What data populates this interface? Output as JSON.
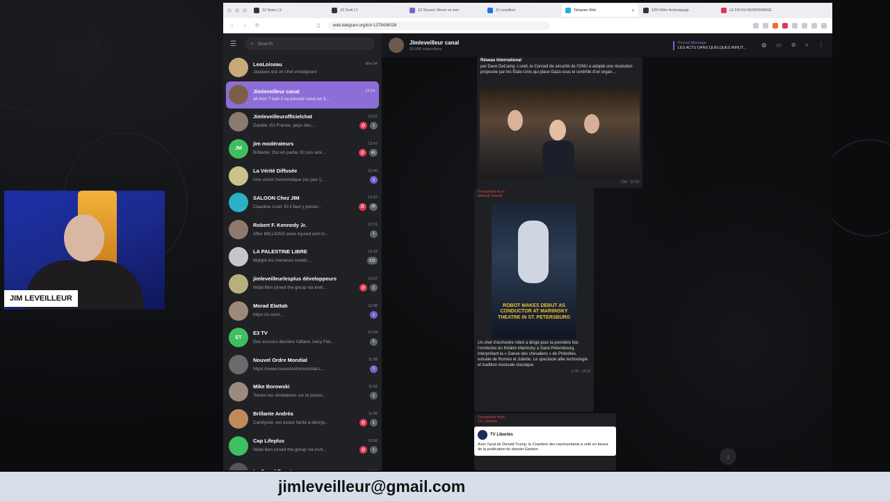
{
  "browser": {
    "tabs": [
      {
        "title": "ZZ Notes | X",
        "color": "#333"
      },
      {
        "title": "ZZ Draft | X",
        "color": "#333"
      },
      {
        "title": "ZZ Discord: Moner en vers",
        "color": "#7d5fd0"
      },
      {
        "title": "Zz Leveilleur",
        "color": "#1a73e8"
      },
      {
        "title": "Telegram Web",
        "color": "#29a9eb",
        "active": true
      },
      {
        "title": "ZZR-Hêtre Archiviquage",
        "color": "#333"
      },
      {
        "title": "LE FIN DU MUNDOMINGE",
        "color": "#e0364f"
      }
    ],
    "url": "web.telegram.org/k/#-1379436028",
    "close_glyph": "✕"
  },
  "telegram": {
    "search_placeholder": "Search",
    "chats": [
      {
        "name": "LeoLoiseau",
        "time": "Mar 04",
        "msg": "Jacques est un chef enseignant",
        "avatar_color": "#c8a97a",
        "badge": "",
        "mention": false
      },
      {
        "name": "Jimleveilleur canal",
        "time": "12:10",
        "msg": "ah bon ? bah il va pouvoir nous en fi...",
        "avatar_color": "#7a5e4a",
        "badge": "",
        "mention": false,
        "active": true
      },
      {
        "name": "Jimleveilleurofficielchat",
        "time": "12:07",
        "msg": "Davide: En France, pays des...",
        "avatar_color": "#8a7a70",
        "badge": "1",
        "mention": true
      },
      {
        "name": "jim modérateurs",
        "time": "12:47",
        "msg": "Brillante: Oui en partie. Et son ami...",
        "avatar_color": "#3fbf5f",
        "initials": "JM",
        "badge": "41",
        "mention": true
      },
      {
        "name": "La Vérité Diffusée",
        "time": "12:00",
        "msg": "Une vision humoristique (ou pas !)...",
        "avatar_color": "#c9c28a",
        "badge": "5",
        "mention": false,
        "purple": true
      },
      {
        "name": "SALOON Chez JIM",
        "time": "12:47",
        "msg": "Claudine Livet: Et il faut y préser...",
        "avatar_color": "#2bb1c4",
        "badge": "32",
        "mention": true
      },
      {
        "name": "Robert F. Kennedy Jr.",
        "time": "12:31",
        "msg": "After MILLIONS were injured and m...",
        "avatar_color": "#8d7a6c",
        "badge": "1",
        "mention": false
      },
      {
        "name": "LA PALESTINE LIBRE",
        "time": "12:19",
        "msg": "Malgré les menaces israéli...",
        "avatar_color": "#c7c7c7",
        "badge": "131",
        "mention": false
      },
      {
        "name": "jimleveilleurlesplus développeurs",
        "time": "12:07",
        "msg": "Nidal Ben joined the group via invit...",
        "avatar_color": "#b8b07a",
        "badge": "1",
        "mention": true
      },
      {
        "name": "Morad Elattab",
        "time": "12:05",
        "msg": "https://x.com/...",
        "avatar_color": "#a08878",
        "badge": "1",
        "mention": false,
        "purple": true
      },
      {
        "name": "E3 TV",
        "time": "12:04",
        "msg": "Des escrocs derrière l'affaire Juicy Fiel...",
        "avatar_color": "#3fbf5f",
        "initials": "ET",
        "badge": "1",
        "mention": false
      },
      {
        "name": "Nouvel Ordre Mondial",
        "time": "11:58",
        "msg": "https://www.nouvelordremondial.c...",
        "avatar_color": "#6a6a6a",
        "badge": "1",
        "mention": false,
        "purple": true
      },
      {
        "name": "Mike Borowski",
        "time": "11:53",
        "msg": "Toutes les révélations sur le pouvo...",
        "avatar_color": "#9b8a7e",
        "badge": "1",
        "mention": false
      },
      {
        "name": "Brillante Andréa",
        "time": "11:49",
        "msg": "Candysse, est assez facile à décryp...",
        "avatar_color": "#c28a5a",
        "badge": "1",
        "mention": true
      },
      {
        "name": "Cap Lifeplus",
        "time": "10:56",
        "msg": "Nidal Ben joined the group via invit...",
        "avatar_color": "#3fbf5f",
        "badge": "1",
        "mention": true
      },
      {
        "name": "Le Grand Reset",
        "time": "10:40",
        "msg": "",
        "avatar_color": "#555",
        "badge": "",
        "mention": false
      }
    ],
    "channel": {
      "title": "Jimleveilleur canal",
      "subscribers": "15 996 subscribers",
      "pinned_label": "Pinned Message",
      "pinned_text": "LES ACTU DANS QUELQUES MINUT..."
    },
    "posts": {
      "first_source": "Réseau International",
      "first_text": "par Dave DeCamp. Lundi, le Conseil de sécurité de l'ONU a adopté une résolution proposée par les États-Unis qui place Gaza sous le contrôle d'un organ...",
      "first_meta": "1,5K · 12:19",
      "second_forward": "Forwarded from",
      "second_forward_name": "Mikhail Tweets",
      "video_caption": "ROBOT MAKES DEBUT AS CONDUCTOR AT MARIINSKY THEATRE IN ST. PETERSBURG",
      "second_text": "Un chef d'orchestre robot a dirigé pour la première fois l'orchestre du théâtre Mariinsky à Saint-Pétersbourg, interprétant la « Danse des chevaliers » de Prokofiev, extraite de Roméo et Juliette. Le spectacle allie technologie et tradition musicale classique.",
      "second_meta": "1,7K · 12:19",
      "third_forward": "Forwarded from",
      "third_forward_name": "TV Libertés",
      "embed_name": "TV Libertés",
      "embed_text": "Avec l'aval de Donald Trump, la Chambre des représentants a voté en faveur de la publication du dossier Epstein."
    }
  },
  "webcam": {
    "name_tag": "JIM LEVEILLEUR"
  },
  "footer": {
    "email": "jimleveilleur@gmail.com"
  }
}
